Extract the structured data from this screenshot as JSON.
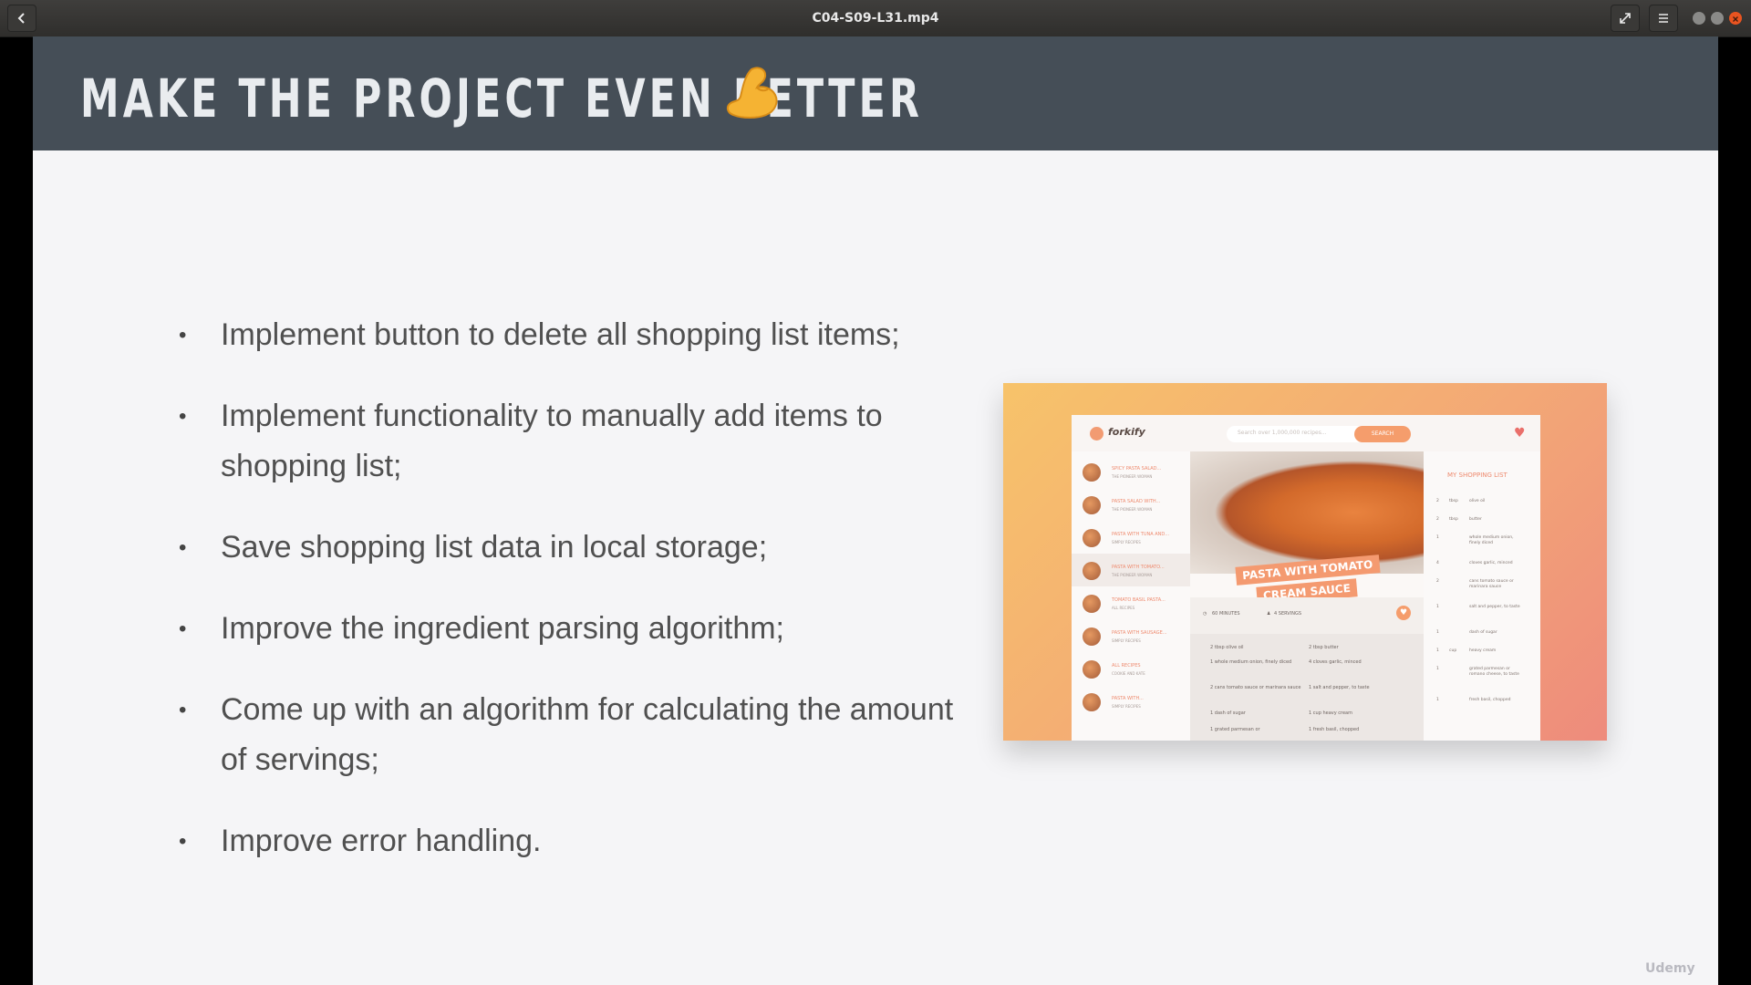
{
  "window": {
    "title": "C04-S09-L31.mp4",
    "back_icon": "chevron-left-icon",
    "fullscreen_icon": "expand-icon",
    "menu_icon": "hamburger-icon",
    "controls": {
      "minimize": "#8a8a88",
      "maximize": "#8a8a88",
      "close": "#e95420"
    }
  },
  "slide": {
    "title": "MAKE THE PROJECT EVEN BETTER",
    "title_emoji": "flexed-biceps-icon",
    "banner_color": "#454e57",
    "bullets": [
      "Implement button to delete all shopping list items;",
      "Implement functionality to manually add items to shopping list;",
      "Save shopping list data in local storage;",
      "Improve the ingredient parsing algorithm;",
      "Come up with an algorithm for calculating the amount of servings;",
      "Improve error handling."
    ],
    "watermark": "Udemy"
  },
  "preview": {
    "logo": "forkify",
    "search_placeholder": "Search over 1,000,000 recipes...",
    "search_button": "SEARCH",
    "recipes": [
      {
        "title": "SPICY PASTA SALAD...",
        "publisher": "THE PIONEER WOMAN"
      },
      {
        "title": "PASTA SALAD WITH...",
        "publisher": "THE PIONEER WOMAN"
      },
      {
        "title": "PASTA WITH TUNA AND...",
        "publisher": "SIMPLY RECIPES"
      },
      {
        "title": "PASTA WITH TOMATO...",
        "publisher": "THE PIONEER WOMAN"
      },
      {
        "title": "TOMATO BASIL PASTA...",
        "publisher": "ALL RECIPES"
      },
      {
        "title": "PASTA WITH SAUSAGE...",
        "publisher": "SIMPLY RECIPES"
      },
      {
        "title": "ALL RECIPES",
        "publisher": "COOKIE AND KATE"
      },
      {
        "title": "PASTA WITH...",
        "publisher": "SIMPLY RECIPES"
      }
    ],
    "recipe_title_line1": "PASTA WITH TOMATO",
    "recipe_title_line2": "CREAM SAUCE",
    "minutes": "60 MINUTES",
    "servings": "4 SERVINGS",
    "ingredients": [
      "2 tbsp olive oil",
      "2 tbsp butter",
      "1 whole medium onion, finely diced",
      "4 cloves garlic, minced",
      "2 cans tomato sauce or marinara sauce",
      "1 salt and pepper, to taste",
      "1 dash of sugar",
      "1 cup heavy cream",
      "1 grated parmesan or",
      "1 fresh basil, chopped"
    ],
    "shopping_title": "MY SHOPPING LIST",
    "shopping": [
      {
        "q": "2",
        "u": "tbsp",
        "d": "olive oil"
      },
      {
        "q": "2",
        "u": "tbsp",
        "d": "butter"
      },
      {
        "q": "1",
        "u": "",
        "d": "whole medium onion, finely diced"
      },
      {
        "q": "4",
        "u": "",
        "d": "cloves garlic, minced"
      },
      {
        "q": "2",
        "u": "",
        "d": "cans tomato sauce or marinara sauce"
      },
      {
        "q": "1",
        "u": "",
        "d": "salt and pepper, to taste"
      },
      {
        "q": "1",
        "u": "",
        "d": "dash of sugar"
      },
      {
        "q": "1",
        "u": "cup",
        "d": "heavy cream"
      },
      {
        "q": "1",
        "u": "",
        "d": "grated parmesan or romano cheese, to taste"
      },
      {
        "q": "1",
        "u": "",
        "d": "fresh basil, chopped"
      }
    ]
  }
}
